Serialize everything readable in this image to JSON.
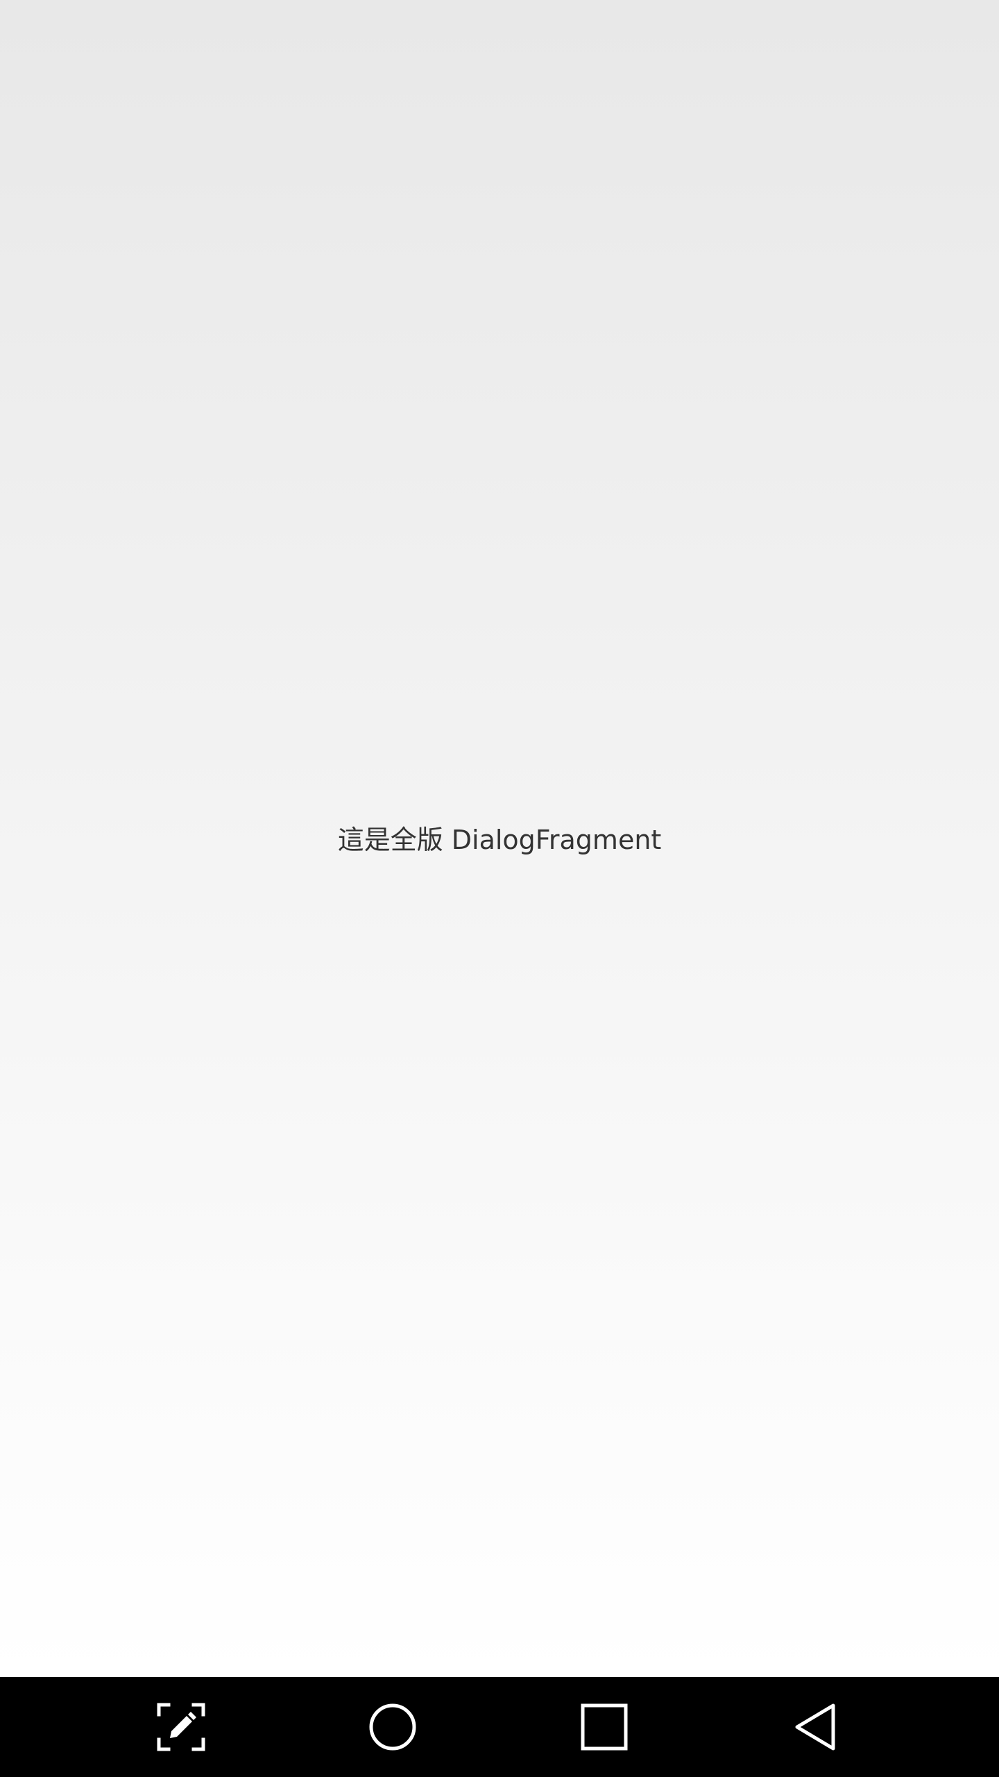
{
  "dialog": {
    "message": "這是全版 DialogFragment"
  },
  "nav_bar": {
    "background": "#000000",
    "icon_color": "#ffffff",
    "buttons": [
      {
        "name": "screenshot-edit-button",
        "icon": "screenshot-edit-icon"
      },
      {
        "name": "home-button",
        "icon": "circle-home-icon"
      },
      {
        "name": "recents-button",
        "icon": "square-recents-icon"
      },
      {
        "name": "back-button",
        "icon": "triangle-back-icon"
      }
    ]
  },
  "colors": {
    "background_top": "#e8e8e8",
    "background_bottom": "#ffffff",
    "text": "#333333"
  }
}
